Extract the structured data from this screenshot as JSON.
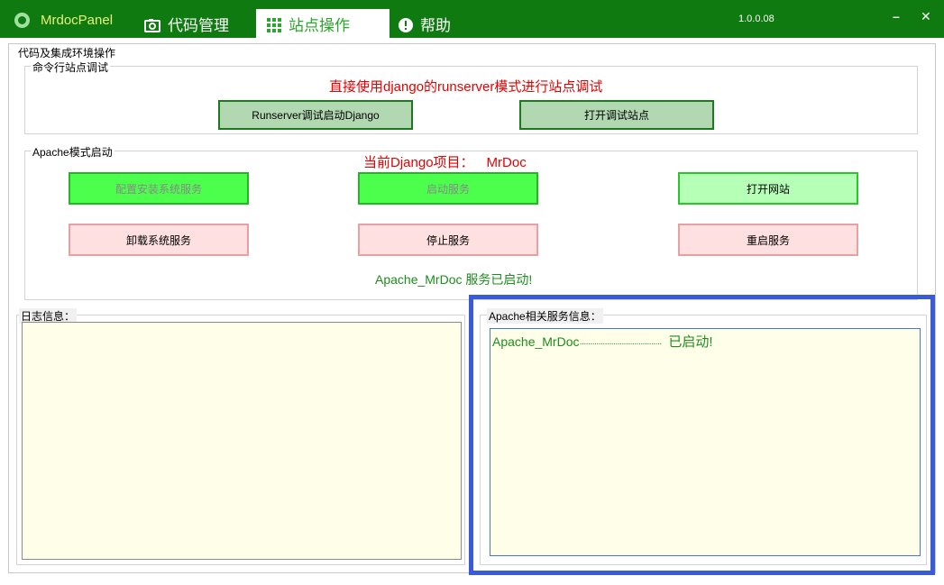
{
  "app": {
    "name": "MrdocPanel",
    "version": "1.0.0.08"
  },
  "tabs": {
    "code": "代码管理",
    "site": "站点操作",
    "help": "帮助"
  },
  "window": {
    "minimize": "–",
    "close": "✕"
  },
  "main": {
    "group_title": "代码及集成环境操作",
    "cli": {
      "legend": "命令行站点调试",
      "hint": "直接使用django的runserver模式进行站点调试",
      "runserver_button": "Runserver调试启动Django",
      "open_debug_button": "打开调试站点"
    },
    "apache": {
      "legend": "Apache模式启动",
      "current_project_label": "当前Django项目：",
      "current_project": "MrDoc",
      "configure_button": "配置安装系统服务",
      "start_button": "启动服务",
      "open_site_button": "打开网站",
      "uninstall_button": "卸载系统服务",
      "stop_button": "停止服务",
      "restart_button": "重启服务",
      "status": "Apache_MrDoc 服务已启动!"
    },
    "log": {
      "legend": "日志信息："
    },
    "service_info": {
      "legend": "Apache相关服务信息：",
      "service_name": "Apache_MrDoc",
      "leader": "·······································",
      "service_status": "已启动!"
    }
  },
  "colors": {
    "titlebar": "#0f7a0f",
    "accent_red": "#e60000",
    "accent_green": "#1e8c1e",
    "highlight_frame": "#3a5bd6"
  }
}
